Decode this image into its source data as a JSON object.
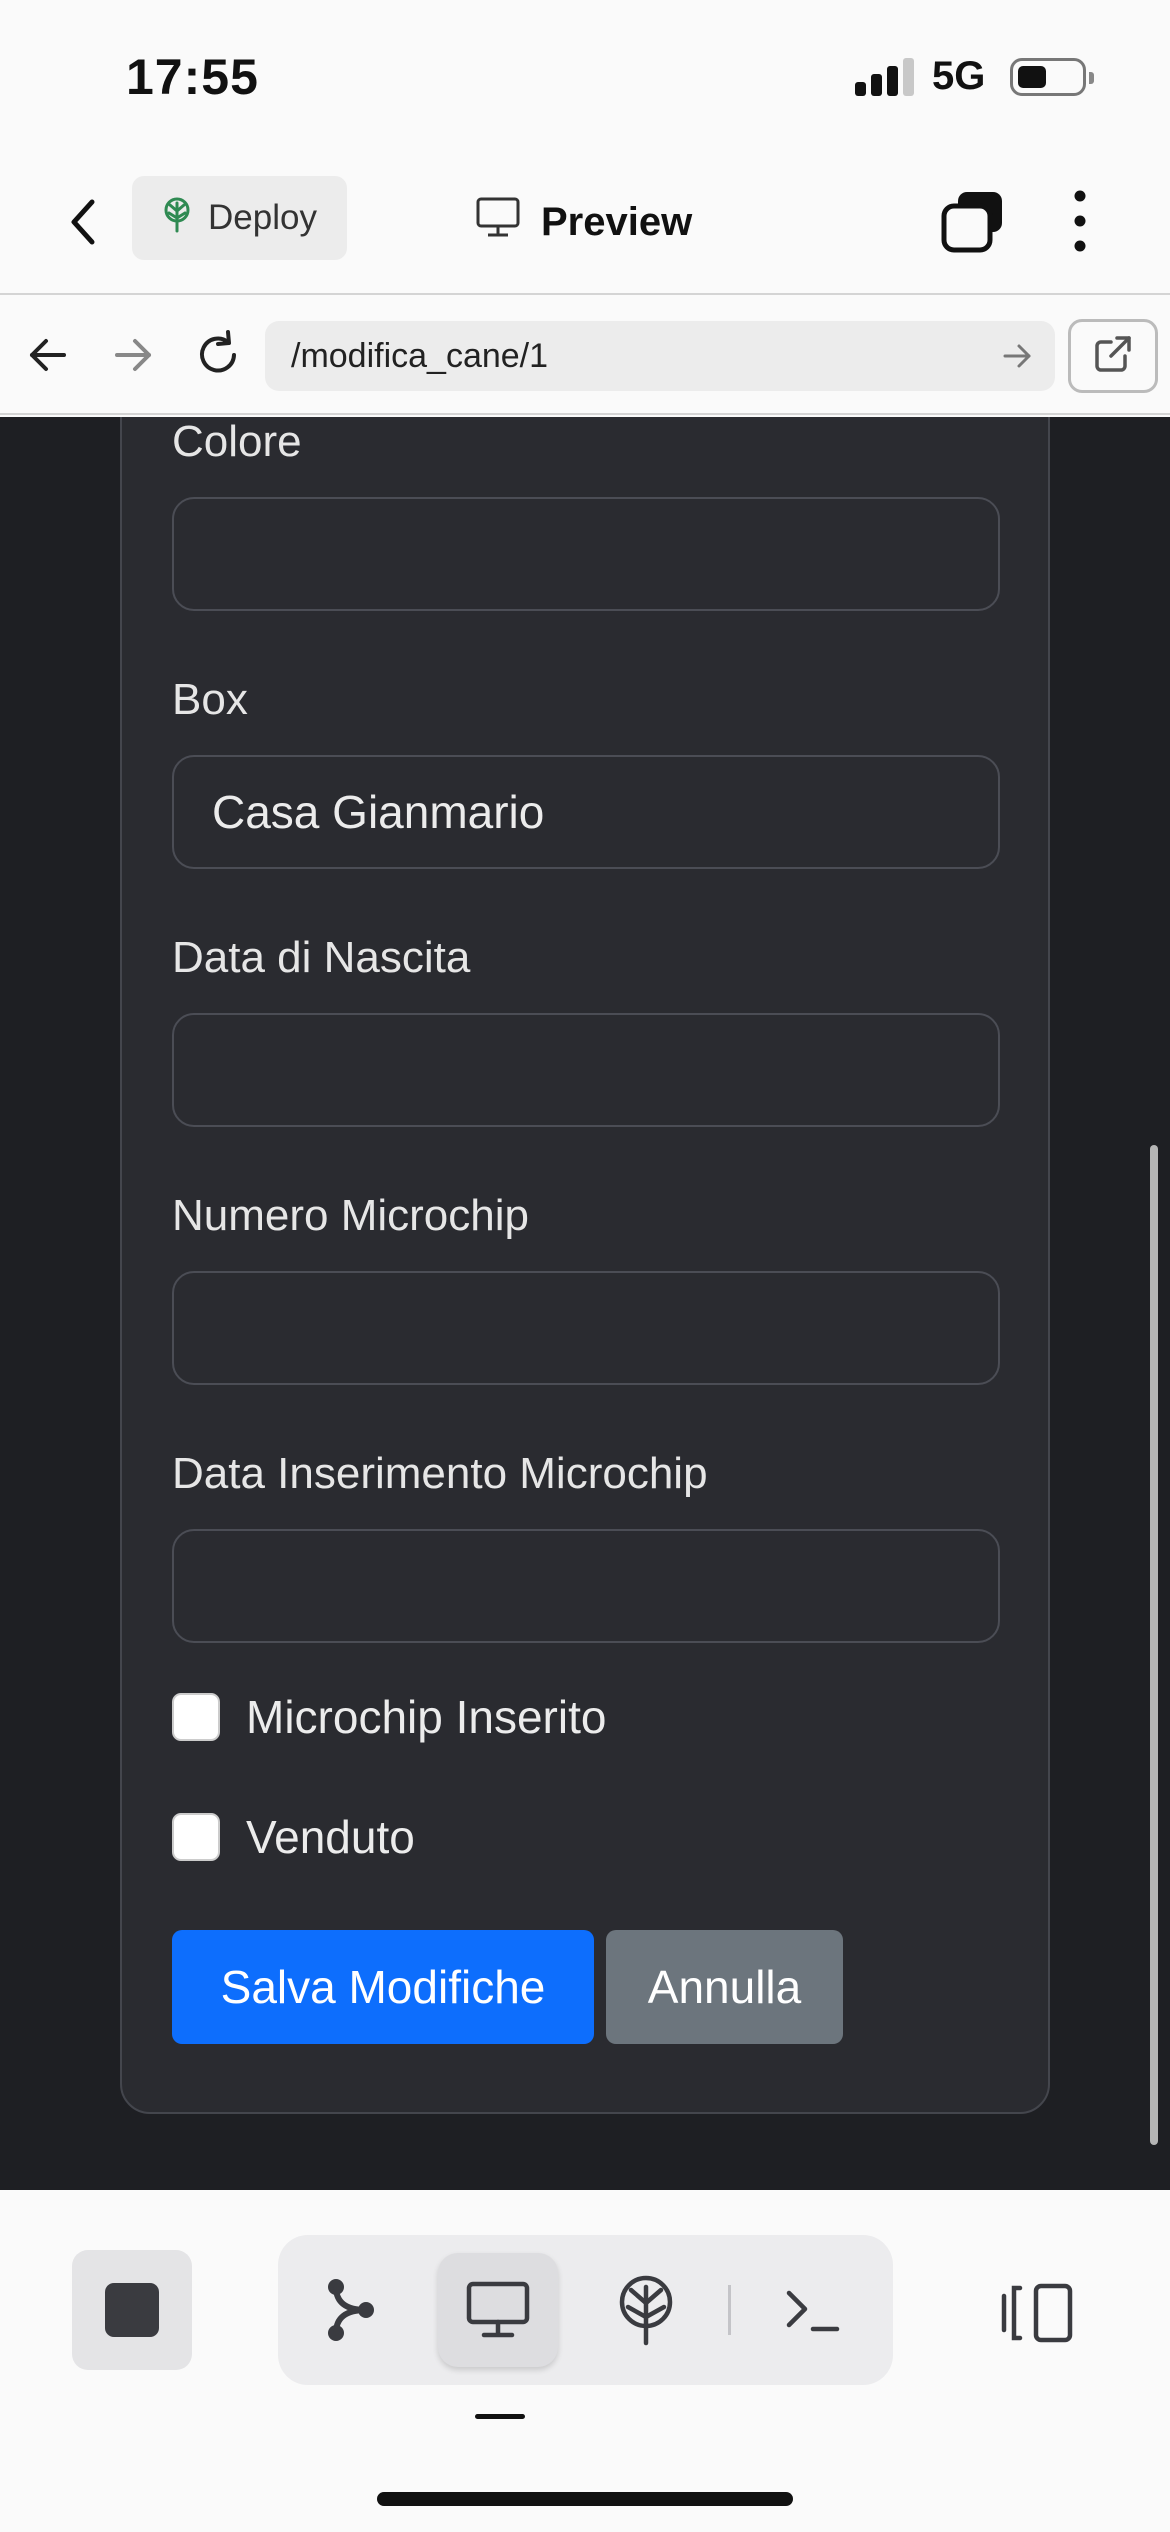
{
  "status_bar": {
    "time": "17:55",
    "network": "5G"
  },
  "header": {
    "deploy_label": "Deploy",
    "preview_label": "Preview"
  },
  "browser": {
    "url": "/modifica_cane/1"
  },
  "form": {
    "fields": [
      {
        "label": "Colore",
        "value": ""
      },
      {
        "label": "Box",
        "value": "Casa Gianmario"
      },
      {
        "label": "Data di Nascita",
        "value": ""
      },
      {
        "label": "Numero Microchip",
        "value": ""
      },
      {
        "label": "Data Inserimento Microchip",
        "value": ""
      }
    ],
    "checkboxes": [
      {
        "label": "Microchip Inserito",
        "checked": false
      },
      {
        "label": "Venduto",
        "checked": false
      }
    ],
    "save_label": "Salva Modifiche",
    "cancel_label": "Annulla"
  },
  "colors": {
    "primary": "#0d6efd",
    "secondary": "#6c757d",
    "page_bg": "#1e1f23",
    "card_bg": "#2a2b30",
    "deploy_icon": "#2f8a52"
  },
  "icons": {
    "header": [
      "back-chevron-icon",
      "deploy-tree-icon",
      "monitor-icon",
      "tabs-icon",
      "more-vertical-icon"
    ],
    "browser": [
      "arrow-left-icon",
      "arrow-right-icon",
      "reload-icon",
      "go-arrow-icon",
      "external-link-icon"
    ],
    "toolbar": [
      "stop-icon",
      "workflow-icon",
      "monitor-icon",
      "deploy-icon",
      "terminal-icon",
      "panel-icon"
    ]
  }
}
